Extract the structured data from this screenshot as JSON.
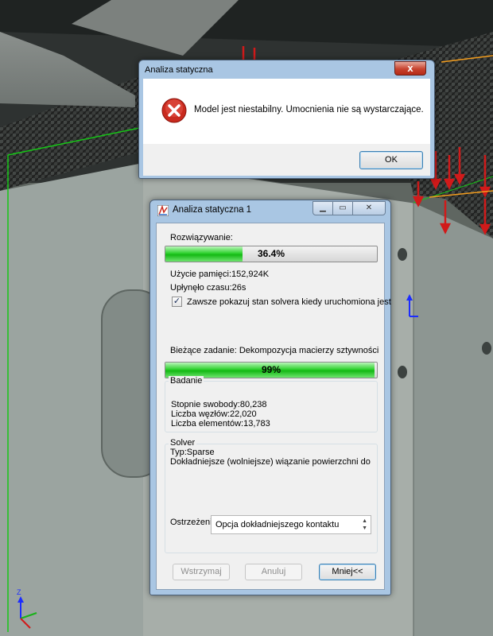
{
  "alert_dialog": {
    "title": "Analiza statyczna",
    "close_glyph": "x",
    "icon": "error-icon",
    "message": "Model jest niestabilny. Umocnienia nie są wystarczające.",
    "ok_label": "OK"
  },
  "progress_window": {
    "title": "Analiza statyczna 1",
    "icon": "study-icon",
    "solving_label": "Rozwiązywanie:",
    "solving_progress": {
      "text": "36.4%",
      "fraction": 0.364
    },
    "memory_usage": "Użycie pamięci:152,924K",
    "elapsed_time": "Upłynęło czasu:26s",
    "always_show": {
      "label": "Zawsze pokazuj stan solvera kiedy uruchomiona jest",
      "checked": true
    },
    "current_task": "Bieżące zadanie: Dekompozycja macierzy sztywności",
    "task_progress": {
      "text": "99%",
      "fraction": 0.99
    },
    "study_group": {
      "title": "Badanie",
      "dof": "Stopnie swobody:80,238",
      "nodes": "Liczba węzłów:22,020",
      "elements": "Liczba elementów:13,783"
    },
    "solver_group": {
      "title": "Solver",
      "type": "Typ:Sparse",
      "bonding": "Dokładniejsze (wolniejsze) wiązanie powierzchni do",
      "warnings_label": "Ostrzeżenia",
      "warnings_value": "Opcja dokładniejszego kontaktu"
    },
    "buttons": {
      "pause": "Wstrzymaj",
      "cancel": "Anuluj",
      "less": "Mniej<<"
    }
  },
  "colors": {
    "progress_green": "#1fcc1f",
    "titlebar": "#a9c6e3",
    "load_arrow": "#d11a1a"
  }
}
